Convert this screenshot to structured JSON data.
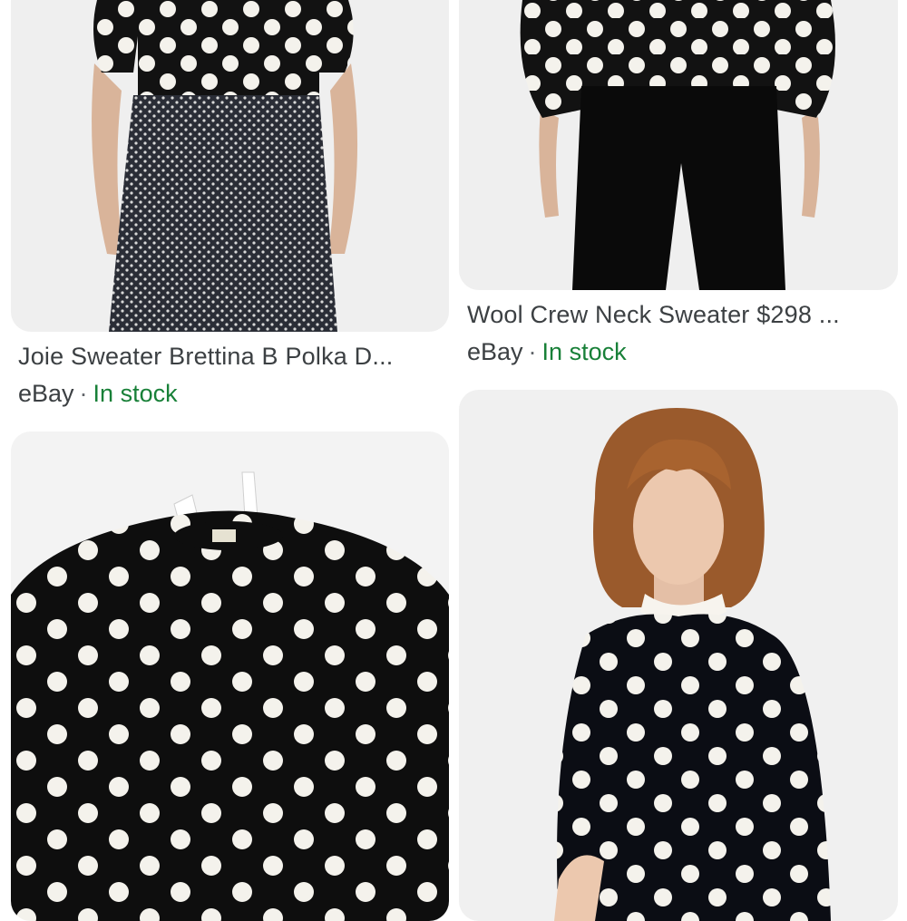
{
  "results": [
    {
      "title": "Joie Sweater Brettina B Polka D...",
      "source": "eBay",
      "separator": "·",
      "availability": "In stock"
    },
    {
      "title": "Wool Crew Neck Sweater $298 ...",
      "source": "eBay",
      "separator": "·",
      "availability": "In stock"
    },
    {
      "title": "",
      "source": "",
      "separator": "",
      "availability": ""
    },
    {
      "title": "",
      "source": "",
      "separator": "",
      "availability": ""
    }
  ],
  "colors": {
    "title_text": "#3c4043",
    "in_stock": "#188038",
    "card_background": "#efefef",
    "sweater_black": "#121212",
    "dot_white": "#f4f2ec"
  },
  "icons": [
    "product-photo-model-skirt",
    "product-photo-model-pants",
    "product-photo-sweater-flat",
    "product-photo-model-portrait"
  ]
}
